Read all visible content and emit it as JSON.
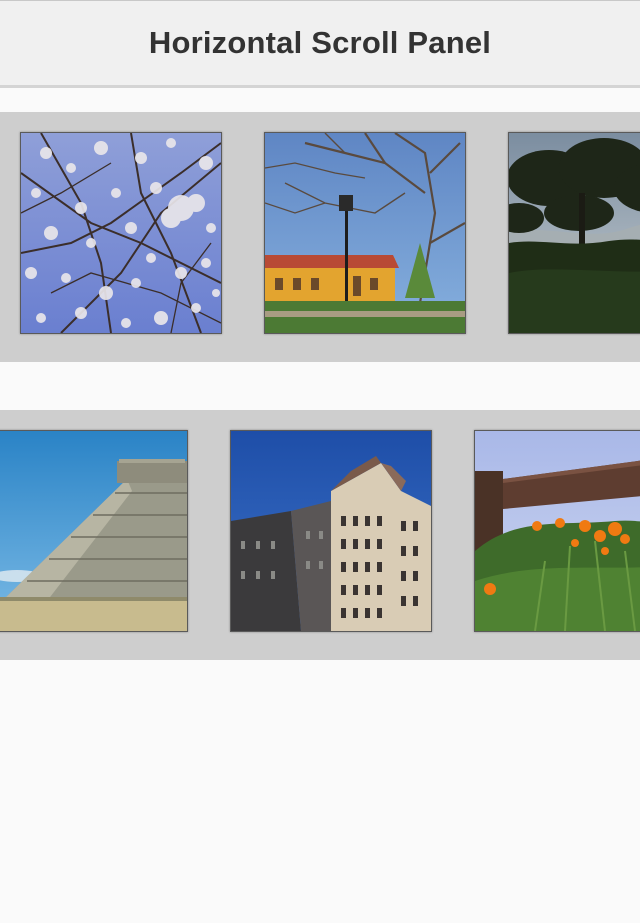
{
  "nav": {
    "title": "Horizontal Scroll Panel"
  },
  "panels": [
    {
      "images": [
        {
          "subject": "white blossom branches against blue sky"
        },
        {
          "subject": "yellow station building with bare tree and lamp post"
        },
        {
          "subject": "pine tree silhouette on a hillside"
        }
      ]
    },
    {
      "images": [
        {
          "subject": "stepped stone pyramid under blue sky"
        },
        {
          "subject": "ornate stone office building against blue sky"
        },
        {
          "subject": "orange poppies beside a wooden fence"
        }
      ]
    }
  ],
  "colors": {
    "panel_background": "#cecece",
    "nav_background": "#f0f0f0",
    "page_background": "#fafafa",
    "title_text": "#333333"
  }
}
